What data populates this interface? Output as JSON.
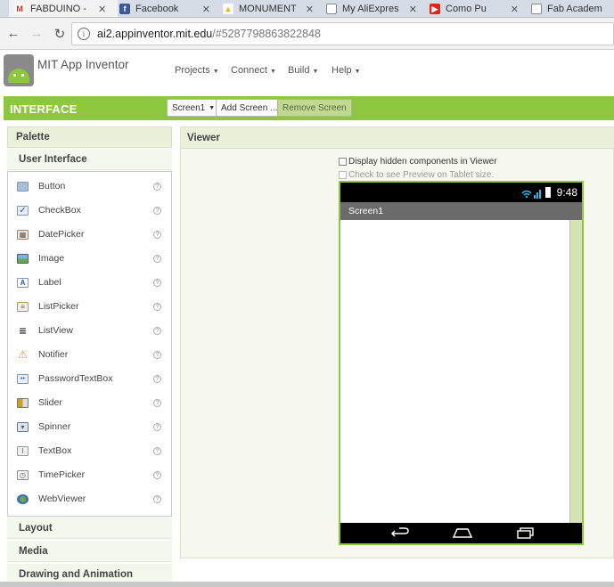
{
  "browser": {
    "tabs": [
      {
        "title": "FABDUINO -",
        "icon": "gmail-icon",
        "color": "#d93025",
        "glyph": "M"
      },
      {
        "title": "Facebook",
        "icon": "facebook-icon",
        "color": "#3b5998",
        "glyph": "f"
      },
      {
        "title": "MONUMENT",
        "icon": "drive-icon",
        "color": "#f4b400",
        "glyph": "▲"
      },
      {
        "title": "My AliExpres",
        "icon": "page-icon",
        "color": "#ffffff",
        "glyph": ""
      },
      {
        "title": "Como Pu",
        "icon": "youtube-icon",
        "color": "#e62117",
        "glyph": "▶"
      },
      {
        "title": "Fab Academ",
        "icon": "page-icon",
        "color": "#ffffff",
        "glyph": ""
      }
    ],
    "url_host": "ai2.appinventor.mit.edu",
    "url_path": "/#5287798863822848"
  },
  "app": {
    "title": "MIT App Inventor",
    "menus": [
      "Projects",
      "Connect",
      "Build",
      "Help"
    ]
  },
  "toolbar": {
    "section": "INTERFACE",
    "screen_select": "Screen1",
    "add_screen": "Add Screen ...",
    "remove_screen": "Remove Screen"
  },
  "palette": {
    "header": "Palette",
    "open_category": "User Interface",
    "items": [
      {
        "label": "Button",
        "icon": "button-icon"
      },
      {
        "label": "CheckBox",
        "icon": "checkbox-icon"
      },
      {
        "label": "DatePicker",
        "icon": "datepicker-icon"
      },
      {
        "label": "Image",
        "icon": "image-icon"
      },
      {
        "label": "Label",
        "icon": "label-icon"
      },
      {
        "label": "ListPicker",
        "icon": "listpicker-icon"
      },
      {
        "label": "ListView",
        "icon": "listview-icon"
      },
      {
        "label": "Notifier",
        "icon": "notifier-icon"
      },
      {
        "label": "PasswordTextBox",
        "icon": "passwordtextbox-icon"
      },
      {
        "label": "Slider",
        "icon": "slider-icon"
      },
      {
        "label": "Spinner",
        "icon": "spinner-icon"
      },
      {
        "label": "TextBox",
        "icon": "textbox-icon"
      },
      {
        "label": "TimePicker",
        "icon": "timepicker-icon"
      },
      {
        "label": "WebViewer",
        "icon": "webviewer-icon"
      }
    ],
    "help_glyph": "?",
    "categories": [
      "Layout",
      "Media",
      "Drawing and Animation"
    ]
  },
  "viewer": {
    "header": "Viewer",
    "display_hidden": "Display hidden components in Viewer",
    "tablet_preview": "Check to see Preview on Tablet size.",
    "status_time": "9:48",
    "screen_title": "Screen1"
  },
  "colors": {
    "accent": "#8dc63f"
  }
}
